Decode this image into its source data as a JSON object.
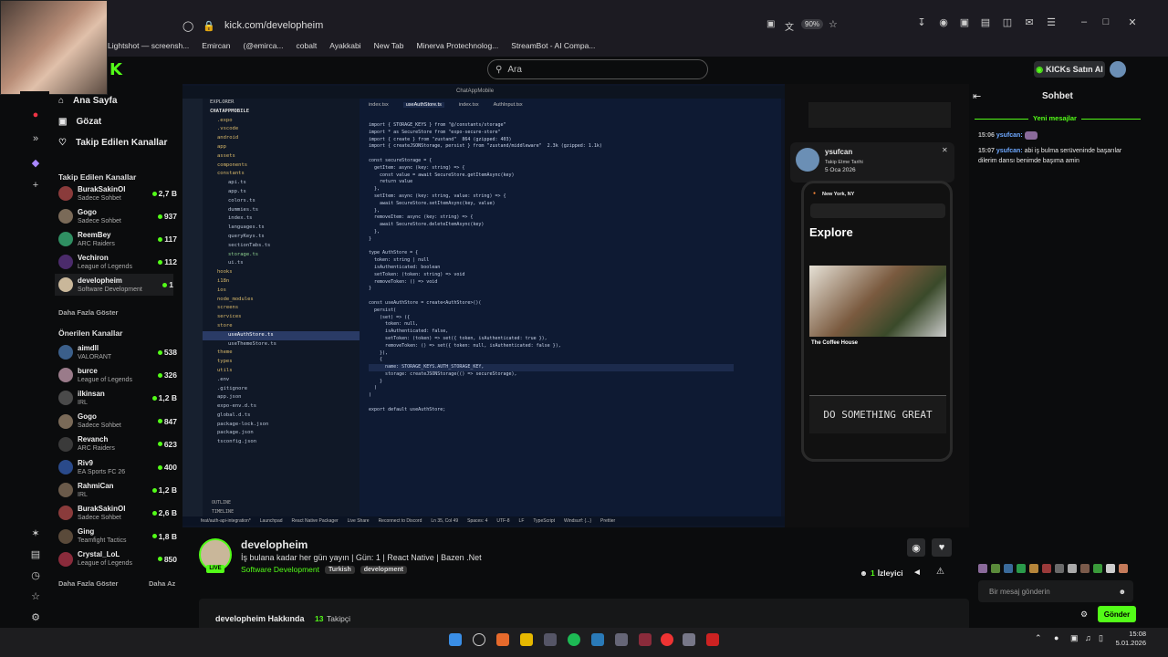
{
  "browser": {
    "url": "kick.com/developheim",
    "zoom": "90%",
    "bookmarks": [
      "Lightshot — screensh...",
      "Emircan",
      "(@emirca...",
      "cobalt",
      "Ayakkabi",
      "New Tab",
      "Minerva Protechnolog...",
      "StreamBot - AI Compa..."
    ]
  },
  "header": {
    "search_placeholder": "Ara",
    "buy_kicks_label": "KICKs Satın Al"
  },
  "nav": {
    "home": "Ana Sayfa",
    "browse": "Gözat",
    "following": "Takip Edilen Kanallar"
  },
  "followed": {
    "title": "Takip Edilen Kanallar",
    "channels": [
      {
        "name": "BurakSakinOl",
        "category": "Sadece Sohbet",
        "viewers": "2,7 B",
        "color": "#8a3b3b"
      },
      {
        "name": "Gogo",
        "category": "Sadece Sohbet",
        "viewers": "937",
        "color": "#7a6a58"
      },
      {
        "name": "ReemBey",
        "category": "ARC Raiders",
        "viewers": "117",
        "color": "#2f8f62"
      },
      {
        "name": "Vechiron",
        "category": "League of Legends",
        "viewers": "112",
        "color": "#4b2b6b"
      },
      {
        "name": "developheim",
        "category": "Software Development",
        "viewers": "1",
        "color": "#c9b79a"
      }
    ],
    "show_more": "Daha Fazla Göster"
  },
  "recommended": {
    "title": "Önerilen Kanallar",
    "channels": [
      {
        "name": "aimdll",
        "category": "VALORANT",
        "viewers": "538",
        "color": "#3b5f8a"
      },
      {
        "name": "burce",
        "category": "League of Legends",
        "viewers": "326",
        "color": "#9a7b8a"
      },
      {
        "name": "ilkinsan",
        "category": "IRL",
        "viewers": "1,2 B",
        "color": "#4a4a4a"
      },
      {
        "name": "Gogo",
        "category": "Sadece Sohbet",
        "viewers": "847",
        "color": "#7a6a58"
      },
      {
        "name": "Revanch",
        "category": "ARC Raiders",
        "viewers": "623",
        "color": "#3a3a3a"
      },
      {
        "name": "Riv9",
        "category": "EA Sports FC 26",
        "viewers": "400",
        "color": "#2a4a8a"
      },
      {
        "name": "RahmiCan",
        "category": "IRL",
        "viewers": "1,2 B",
        "color": "#6a5a4a"
      },
      {
        "name": "BurakSakinOl",
        "category": "Sadece Sohbet",
        "viewers": "2,6 B",
        "color": "#8a3b3b"
      },
      {
        "name": "Ging",
        "category": "Teamfight Tactics",
        "viewers": "1,8 B",
        "color": "#5a4a3a"
      },
      {
        "name": "Crystal_LoL",
        "category": "League of Legends",
        "viewers": "850",
        "color": "#8a2b3b"
      }
    ],
    "show_more": "Daha Fazla Göster",
    "show_less": "Daha Az"
  },
  "stream": {
    "channel": "developheim",
    "title": "İş bulana kadar her gün yayın | Gün: 1 | React Native | Bazen .Net",
    "category": "Software Development",
    "tags": [
      "Turkish",
      "development"
    ],
    "live_label": "LIVE",
    "viewers_count": "1",
    "viewers_label": "İzleyici",
    "about_label": "developheim Hakkında",
    "followers_count": "13",
    "followers_label": "Takipçi"
  },
  "vscode": {
    "window_title": "ChatAppMobile",
    "explorer_title": "EXPLORER",
    "project": "CHATAPPMOBILE",
    "files": [
      ".expo",
      ".vscode",
      "android",
      "app",
      "assets",
      "components",
      "constants",
      "api.ts",
      "app.ts",
      "colors.ts",
      "dummies.ts",
      "index.ts",
      "languages.ts",
      "queryKeys.ts",
      "sectionTabs.ts",
      "storage.ts",
      "ui.ts",
      "hooks",
      "i18n",
      "ios",
      "node_modules",
      "screens",
      "services",
      "store",
      "useAuthStore.ts",
      "useThemeStore.ts",
      "theme",
      "types",
      "utils",
      ".env",
      ".gitignore",
      "app.json",
      "expo-env.d.ts",
      "global.d.ts",
      "package-lock.json",
      "package.json",
      "tsconfig.json"
    ],
    "tabs": [
      "index.tsx",
      "useAuthStore.ts",
      "index.tsx",
      "AuthInput.tsx"
    ],
    "code_lines": [
      "import { STORAGE_KEYS } from \"@/constants/storage\"",
      "import * as SecureStore from \"expo-secure-store\"",
      "import { create } from \"zustand\"  864 (gzipped: 403)",
      "import { createJSONStorage, persist } from \"zustand/middleware\"  2.3k (gzipped: 1.1k)",
      "",
      "const secureStorage = {",
      "  getItem: async (key: string) => {",
      "    const value = await SecureStore.getItemAsync(key)",
      "    return value",
      "  },",
      "  setItem: async (key: string, value: string) => {",
      "    await SecureStore.setItemAsync(key, value)",
      "  },",
      "  removeItem: async (key: string) => {",
      "    await SecureStore.deleteItemAsync(key)",
      "  },",
      "}",
      "",
      "type AuthStore = {",
      "  token: string | null",
      "  isAuthenticated: boolean",
      "  setToken: (token: string) => void",
      "  removeToken: () => void",
      "}",
      "",
      "const useAuthStore = create<AuthStore>()(",
      "  persist(",
      "    (set) => ({",
      "      token: null,",
      "      isAuthenticated: false,",
      "      setToken: (token) => set({ token, isAuthenticated: true }),",
      "      removeToken: () => set({ token: null, isAuthenticated: false }),",
      "    }),",
      "    {",
      "      name: STORAGE_KEYS.AUTH_STORAGE_KEY,",
      "      storage: createJSONStorage(() => secureStorage),",
      "    }",
      "  )",
      ")",
      "",
      "export default useAuthStore;"
    ],
    "status": [
      "feat/auth-api-integration*",
      "Launchpad",
      "React Native Packager",
      "Live Share",
      "Reconnect to Discord",
      "Ln 35, Col 49",
      "Spaces: 4",
      "UTF-8",
      "LF",
      "TypeScript",
      "Windsurf: {...}",
      "Prettier"
    ],
    "outline": "OUTLINE",
    "timeline": "TIMELINE"
  },
  "phone": {
    "toast_name": "ysufcan",
    "toast_sub": "Takip Etme Tarihi",
    "toast_date": "5 Oca 2026",
    "location": "New York, NY",
    "heading": "Explore",
    "card_title": "The Coffee House",
    "banner": "DO SOMETHING GREAT"
  },
  "chat": {
    "title": "Sohbet",
    "new_messages": "Yeni mesajlar",
    "messages": [
      {
        "time": "15:06",
        "user": "ysufcan:",
        "text": ""
      },
      {
        "time": "15:07",
        "user": "ysufcan:",
        "text": "abi iş bulma serüveninde başarılar dilerim darısı benimde başıma amin"
      }
    ],
    "input_placeholder": "Bir mesaj gönderin",
    "send_label": "Gönder"
  },
  "taskbar": {
    "time": "15:08",
    "date": "5.01.2026"
  }
}
